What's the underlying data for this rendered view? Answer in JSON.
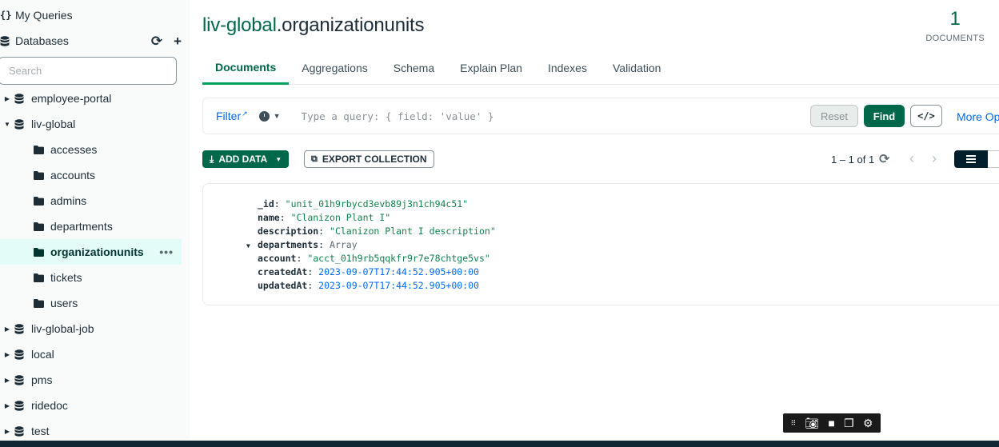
{
  "sidebar": {
    "my_queries": "My Queries",
    "databases": "Databases",
    "search_placeholder": "Search",
    "databases_list": [
      {
        "name": "employee-portal",
        "expanded": false
      },
      {
        "name": "liv-global",
        "expanded": true
      },
      {
        "name": "liv-global-job",
        "expanded": false
      },
      {
        "name": "local",
        "expanded": false
      },
      {
        "name": "pms",
        "expanded": false
      },
      {
        "name": "ridedoc",
        "expanded": false
      },
      {
        "name": "test",
        "expanded": false
      }
    ],
    "collections": [
      "accesses",
      "accounts",
      "admins",
      "departments",
      "organizationunits",
      "tickets",
      "users"
    ],
    "active_collection": "organizationunits"
  },
  "header": {
    "db": "liv-global",
    "collection": ".organizationunits",
    "doc_count": "1",
    "doc_count_label": "DOCUMENTS"
  },
  "tabs": [
    "Documents",
    "Aggregations",
    "Schema",
    "Explain Plan",
    "Indexes",
    "Validation"
  ],
  "active_tab": "Documents",
  "querybar": {
    "filter_label": "Filter",
    "placeholder": "Type a query: { field: 'value' }",
    "reset": "Reset",
    "find": "Find",
    "code": "</>",
    "more_options": "More Op"
  },
  "toolbar": {
    "add_data": "ADD DATA",
    "export": "EXPORT COLLECTION",
    "pager": "1 – 1 of 1"
  },
  "document": {
    "fields": [
      {
        "key": "_id",
        "value": "\"unit_01h9rbycd3evb89j3n1ch94c51\"",
        "kind": "str"
      },
      {
        "key": "name",
        "value": "\"Clanizon Plant I\"",
        "kind": "str"
      },
      {
        "key": "description",
        "value": "\"Clanizon Plant I description\"",
        "kind": "str"
      },
      {
        "key": "departments",
        "value": "Array",
        "kind": "type",
        "expandable": true
      },
      {
        "key": "account",
        "value": "\"acct_01h9rb5qqkfr9r7e78chtge5vs\"",
        "kind": "str"
      },
      {
        "key": "createdAt",
        "value": "2023-09-07T17:44:52.905+00:00",
        "kind": "date"
      },
      {
        "key": "updatedAt",
        "value": "2023-09-07T17:44:52.905+00:00",
        "kind": "date"
      }
    ]
  },
  "colors": {
    "brand_green": "#00684a",
    "link_blue": "#016bf8",
    "active_bg": "#e3fcf7"
  }
}
